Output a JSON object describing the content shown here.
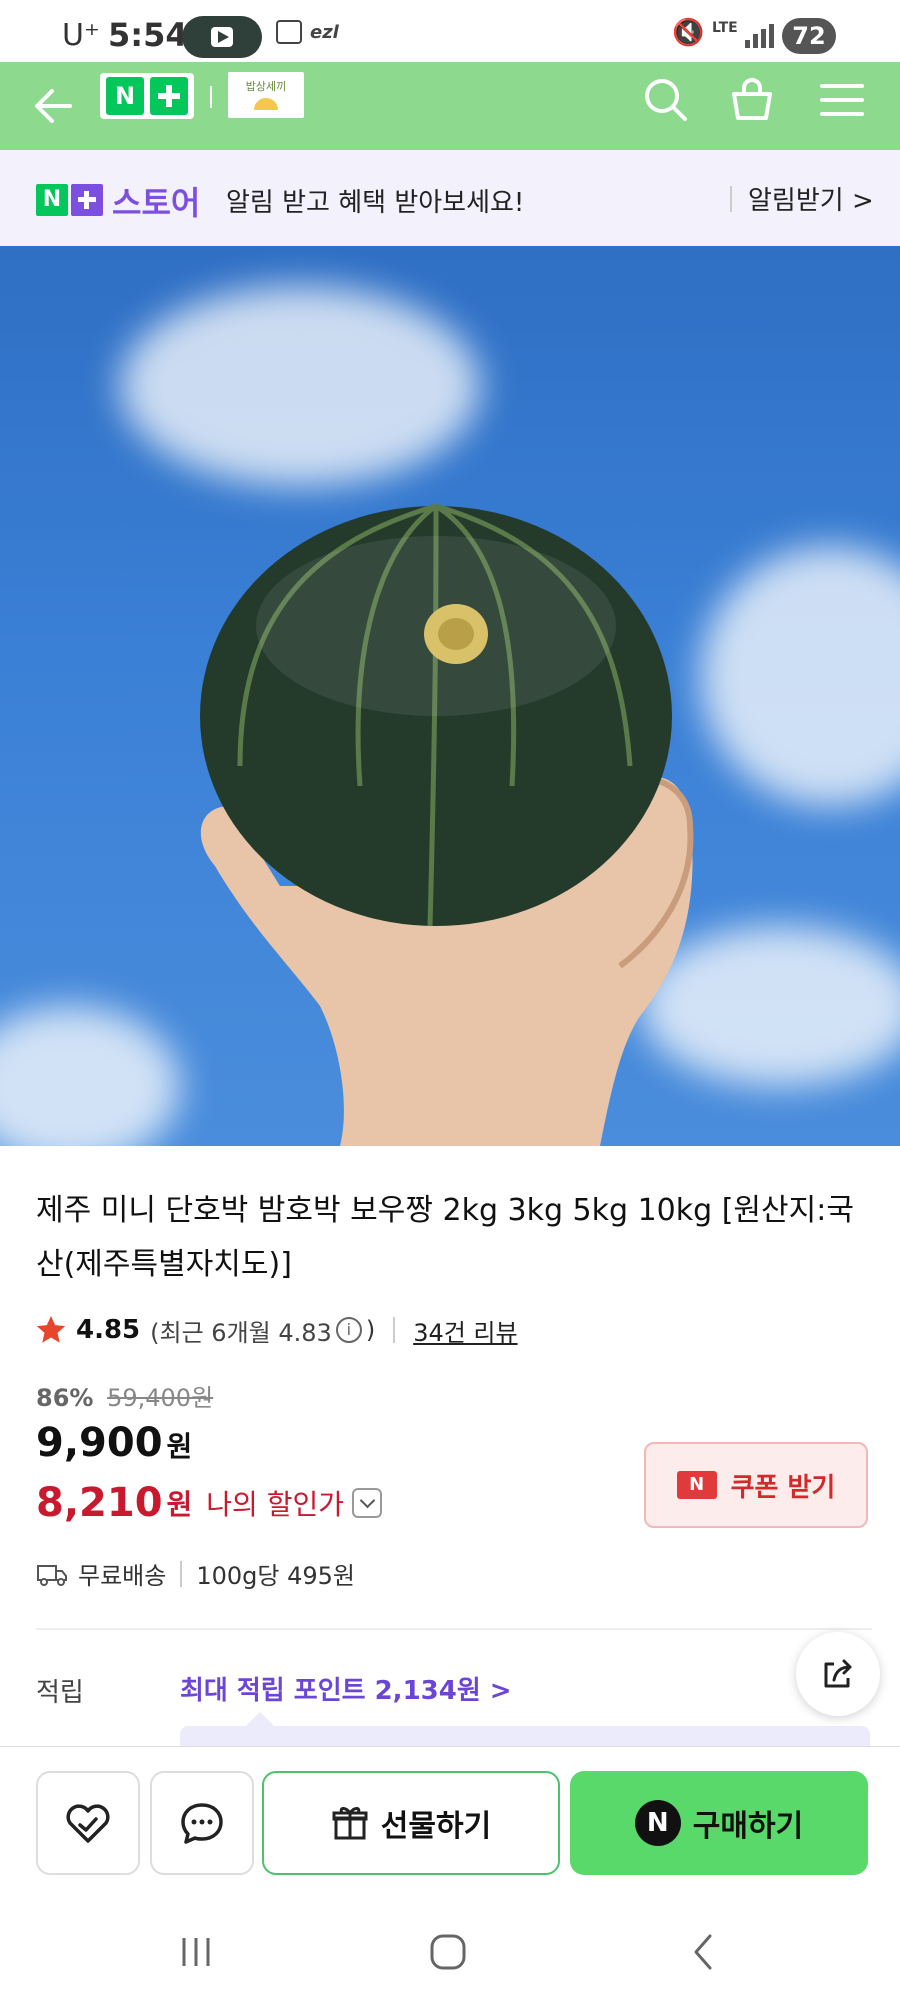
{
  "status_bar": {
    "carrier": "U⁺",
    "time": "5:54",
    "app_badge": "ezl",
    "network": "LTE",
    "battery": "72"
  },
  "header": {
    "logo_n": "N",
    "brand_text": "밥상세끼",
    "icons": [
      "back-arrow-icon",
      "search-icon",
      "cart-icon",
      "menu-icon"
    ]
  },
  "notify_banner": {
    "logo_n": "N",
    "store_label": "스토어",
    "message": "알림 받고 혜택 받아보세요!",
    "button_label": "알림받기 >"
  },
  "product": {
    "title": "제주 미니 단호박 밤호박 보우짱 2kg 3kg 5kg 10kg [원산지:국산(제주특별자치도)]",
    "rating": "4.85",
    "recent_rating": "(최근 6개월 4.83",
    "recent_close": ")",
    "info_glyph": "i",
    "reviews": "34건 리뷰",
    "discount_pct": "86%",
    "original_price": "59,400원",
    "price_value": "9,900",
    "price_unit": "원",
    "my_price_value": "8,210",
    "my_price_unit": "원",
    "my_price_label": "나의 할인가",
    "coupon_badge": "N",
    "coupon_label": "쿠폰 받기",
    "shipping": "무료배송",
    "unit_price": "100g당 495원",
    "points_label": "적립",
    "points_value": "최대 적립 포인트 2,134원 >"
  },
  "action_bar": {
    "gift_label": "선물하기",
    "buy_badge": "N",
    "buy_label": "구매하기"
  },
  "colors": {
    "header_green": "#8dd98e",
    "naver_green": "#03c75a",
    "store_purple": "#7b4fe0",
    "discount_red": "#c8192e",
    "buy_green": "#58d96a"
  }
}
